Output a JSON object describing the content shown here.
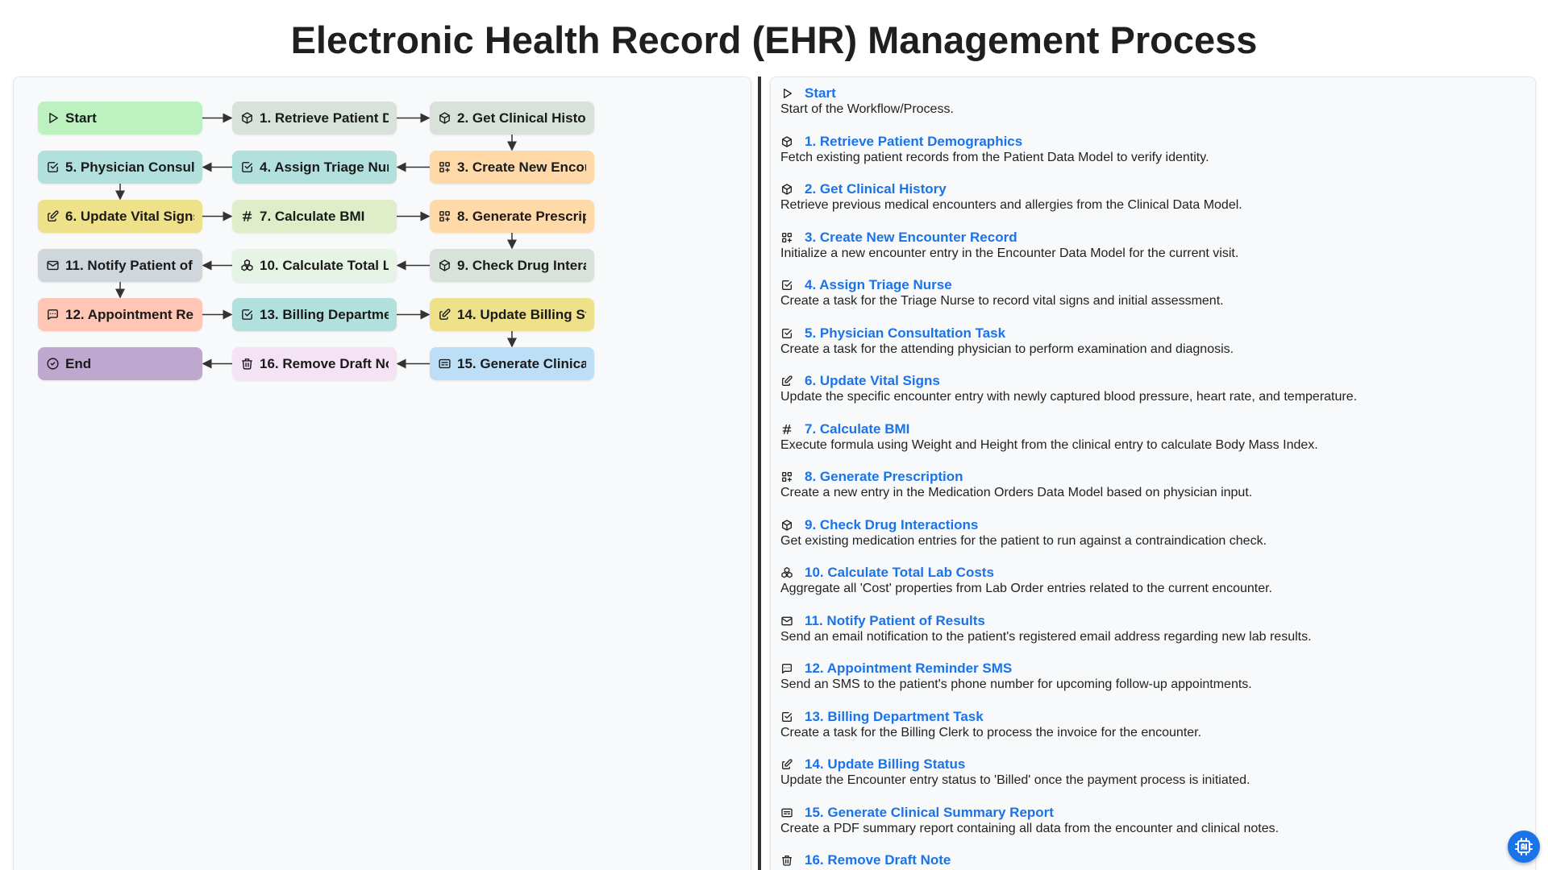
{
  "title": "Electronic Health Record (EHR) Management Process",
  "nodes": [
    {
      "id": "start",
      "label": "Start",
      "icon": "play-icon",
      "color": "#bdf2c0"
    },
    {
      "id": "s1",
      "label": "1. Retrieve Patient Demographics",
      "icon": "cube-icon",
      "color": "#d9e2da"
    },
    {
      "id": "s2",
      "label": "2. Get Clinical History",
      "icon": "cube-icon",
      "color": "#d9e2da"
    },
    {
      "id": "s3",
      "label": "3. Create New Encounter Record",
      "icon": "grid-plus-icon",
      "color": "#ffd9a8"
    },
    {
      "id": "s4",
      "label": "4. Assign Triage Nurse",
      "icon": "checkbox-icon",
      "color": "#b2e0dd"
    },
    {
      "id": "s5",
      "label": "5. Physician Consultation Task",
      "icon": "checkbox-icon",
      "color": "#b2e0dd"
    },
    {
      "id": "s6",
      "label": "6. Update Vital Signs",
      "icon": "edit-icon",
      "color": "#efe18a"
    },
    {
      "id": "s7",
      "label": "7. Calculate BMI",
      "icon": "hash-icon",
      "color": "#dfeec8"
    },
    {
      "id": "s8",
      "label": "8. Generate Prescription",
      "icon": "grid-plus-icon",
      "color": "#ffd9a8"
    },
    {
      "id": "s9",
      "label": "9. Check Drug Interactions",
      "icon": "cube-icon",
      "color": "#d9e2da"
    },
    {
      "id": "s10",
      "label": "10. Calculate Total Lab Costs",
      "icon": "cubes-icon",
      "color": "#e6f4e6"
    },
    {
      "id": "s11",
      "label": "11. Notify Patient of Results",
      "icon": "mail-icon",
      "color": "#cfd6dc"
    },
    {
      "id": "s12",
      "label": "12. Appointment Reminder SMS",
      "icon": "message-icon",
      "color": "#ffc6b5"
    },
    {
      "id": "s13",
      "label": "13. Billing Department Task",
      "icon": "checkbox-icon",
      "color": "#b2e0dd"
    },
    {
      "id": "s14",
      "label": "14. Update Billing Status",
      "icon": "edit-icon",
      "color": "#efe18a"
    },
    {
      "id": "s15",
      "label": "15. Generate Clinical Summary Report",
      "icon": "report-icon",
      "color": "#bcdff7"
    },
    {
      "id": "s16",
      "label": "16. Remove Draft Note",
      "icon": "trash-icon",
      "color": "#f4e3f4"
    },
    {
      "id": "end",
      "label": "End",
      "icon": "check-circle-icon",
      "color": "#bea8cf"
    }
  ],
  "details": [
    {
      "label": "Start",
      "icon": "play-icon",
      "desc": "Start of the Workflow/Process."
    },
    {
      "label": "1. Retrieve Patient Demographics",
      "icon": "cube-icon",
      "desc": "Fetch existing patient records from the Patient Data Model to verify identity."
    },
    {
      "label": "2. Get Clinical History",
      "icon": "cube-icon",
      "desc": "Retrieve previous medical encounters and allergies from the Clinical Data Model."
    },
    {
      "label": "3. Create New Encounter Record",
      "icon": "grid-plus-icon",
      "desc": "Initialize a new encounter entry in the Encounter Data Model for the current visit."
    },
    {
      "label": "4. Assign Triage Nurse",
      "icon": "checkbox-icon",
      "desc": "Create a task for the Triage Nurse to record vital signs and initial assessment."
    },
    {
      "label": "5. Physician Consultation Task",
      "icon": "checkbox-icon",
      "desc": "Create a task for the attending physician to perform examination and diagnosis."
    },
    {
      "label": "6. Update Vital Signs",
      "icon": "edit-icon",
      "desc": "Update the specific encounter entry with newly captured blood pressure, heart rate, and temperature."
    },
    {
      "label": "7. Calculate BMI",
      "icon": "hash-icon",
      "desc": "Execute formula using Weight and Height from the clinical entry to calculate Body Mass Index."
    },
    {
      "label": "8. Generate Prescription",
      "icon": "grid-plus-icon",
      "desc": "Create a new entry in the Medication Orders Data Model based on physician input."
    },
    {
      "label": "9. Check Drug Interactions",
      "icon": "cube-icon",
      "desc": "Get existing medication entries for the patient to run against a contraindication check."
    },
    {
      "label": "10. Calculate Total Lab Costs",
      "icon": "cubes-icon",
      "desc": "Aggregate all 'Cost' properties from Lab Order entries related to the current encounter."
    },
    {
      "label": "11. Notify Patient of Results",
      "icon": "mail-icon",
      "desc": "Send an email notification to the patient's registered email address regarding new lab results."
    },
    {
      "label": "12. Appointment Reminder SMS",
      "icon": "message-icon",
      "desc": "Send an SMS to the patient's phone number for upcoming follow-up appointments."
    },
    {
      "label": "13. Billing Department Task",
      "icon": "checkbox-icon",
      "desc": "Create a task for the Billing Clerk to process the invoice for the encounter."
    },
    {
      "label": "14. Update Billing Status",
      "icon": "edit-icon",
      "desc": "Update the Encounter entry status to 'Billed' once the payment process is initiated."
    },
    {
      "label": "15. Generate Clinical Summary Report",
      "icon": "report-icon",
      "desc": "Create a PDF summary report containing all data from the encounter and clinical notes."
    },
    {
      "label": "16. Remove Draft Note",
      "icon": "trash-icon",
      "desc": ""
    }
  ],
  "fab_icon": "chip-icon"
}
